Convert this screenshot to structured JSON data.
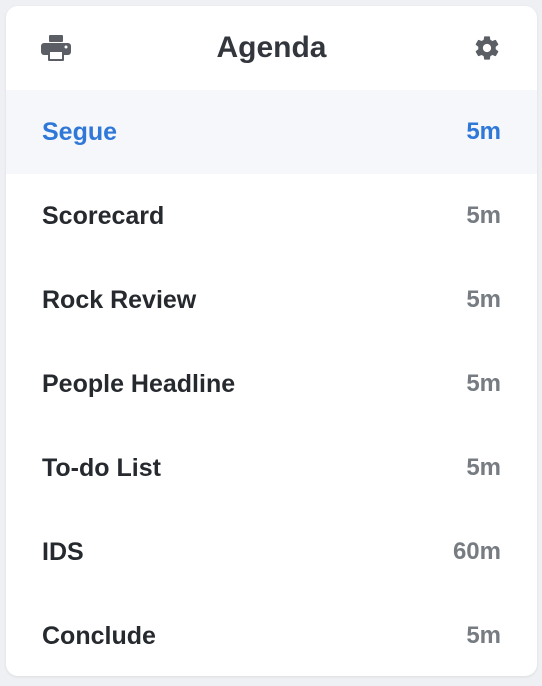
{
  "header": {
    "title": "Agenda",
    "print_icon": "print-icon",
    "settings_icon": "gear-icon"
  },
  "colors": {
    "active_text": "#2f78d8",
    "active_background": "#f5f7fa",
    "label_text": "#262a2f",
    "duration_text": "#777c82"
  },
  "agenda": {
    "items": [
      {
        "label": "Segue",
        "duration": "5m",
        "active": true
      },
      {
        "label": "Scorecard",
        "duration": "5m",
        "active": false
      },
      {
        "label": "Rock Review",
        "duration": "5m",
        "active": false
      },
      {
        "label": "People Headline",
        "duration": "5m",
        "active": false
      },
      {
        "label": "To-do List",
        "duration": "5m",
        "active": false
      },
      {
        "label": "IDS",
        "duration": "60m",
        "active": false
      },
      {
        "label": "Conclude",
        "duration": "5m",
        "active": false
      }
    ]
  }
}
